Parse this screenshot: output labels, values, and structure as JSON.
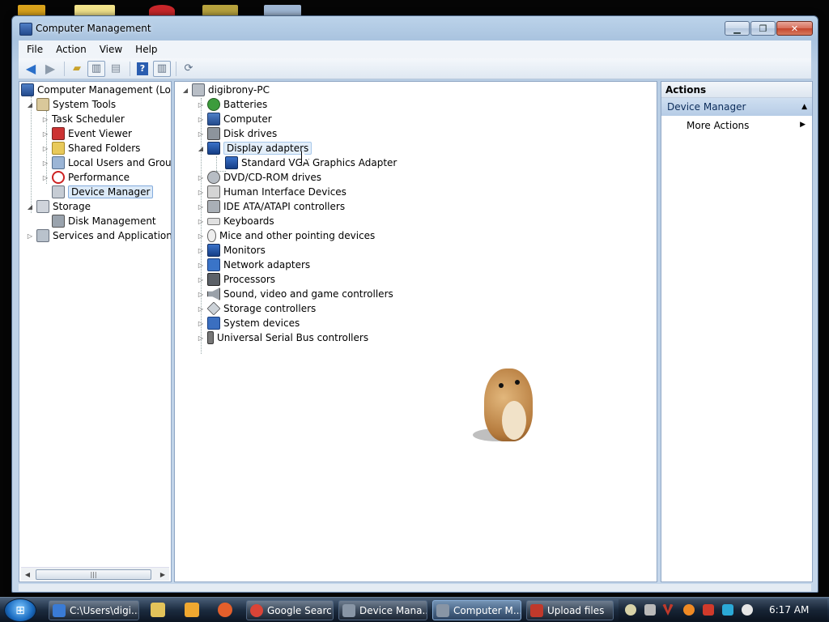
{
  "window": {
    "title": "Computer Management"
  },
  "menubar": {
    "items": [
      "File",
      "Action",
      "View",
      "Help"
    ]
  },
  "toolbar": {
    "buttons": [
      "back-icon",
      "forward-icon",
      "up-folder-icon",
      "show-hide-tree-icon",
      "properties-icon",
      "help-icon",
      "show-hide-action-pane-icon",
      "scan-hardware-icon"
    ]
  },
  "left_tree": {
    "root": "Computer Management (Local",
    "system_tools": "System Tools",
    "task_scheduler": "Task Scheduler",
    "event_viewer": "Event Viewer",
    "shared_folders": "Shared Folders",
    "local_users": "Local Users and Groups",
    "performance": "Performance",
    "device_manager": "Device Manager",
    "storage": "Storage",
    "disk_management": "Disk Management",
    "services_apps": "Services and Applications"
  },
  "device_tree": {
    "computer_name": "digibrony-PC",
    "categories": [
      {
        "label": "Batteries",
        "icon": "battery-icon"
      },
      {
        "label": "Computer",
        "icon": "computer-icon"
      },
      {
        "label": "Disk drives",
        "icon": "disk-drive-icon"
      },
      {
        "label": "Display adapters",
        "icon": "display-adapter-icon",
        "expanded": true
      },
      {
        "label": "Standard VGA Graphics Adapter",
        "icon": "display-adapter-icon",
        "child": true
      },
      {
        "label": "DVD/CD-ROM drives",
        "icon": "cdrom-icon"
      },
      {
        "label": "Human Interface Devices",
        "icon": "hid-icon"
      },
      {
        "label": "IDE ATA/ATAPI controllers",
        "icon": "ide-controller-icon"
      },
      {
        "label": "Keyboards",
        "icon": "keyboard-icon"
      },
      {
        "label": "Mice and other pointing devices",
        "icon": "mouse-icon"
      },
      {
        "label": "Monitors",
        "icon": "monitor-icon"
      },
      {
        "label": "Network adapters",
        "icon": "network-adapter-icon"
      },
      {
        "label": "Processors",
        "icon": "processor-icon"
      },
      {
        "label": "Sound, video and game controllers",
        "icon": "sound-icon"
      },
      {
        "label": "Storage controllers",
        "icon": "storage-controller-icon"
      },
      {
        "label": "System devices",
        "icon": "system-device-icon"
      },
      {
        "label": "Universal Serial Bus controllers",
        "icon": "usb-icon"
      }
    ]
  },
  "actions_pane": {
    "header": "Actions",
    "section": "Device Manager",
    "more_actions": "More Actions"
  },
  "taskbar": {
    "tasks": [
      {
        "label": "C:\\Users\\digi...",
        "icon": "explorer-folder-icon",
        "color": "#3a7bd5"
      },
      {
        "label": "Google Searc...",
        "icon": "chrome-icon",
        "color": "#db4437"
      },
      {
        "label": "Device Mana...",
        "icon": "device-manager-icon",
        "color": "#8895a5"
      },
      {
        "label": "Computer M...",
        "icon": "computer-management-icon",
        "color": "#8895a5",
        "active": true
      },
      {
        "label": "Upload files",
        "icon": "upload-icon",
        "color": "#c0392b"
      }
    ],
    "clock": "6:17 AM"
  }
}
